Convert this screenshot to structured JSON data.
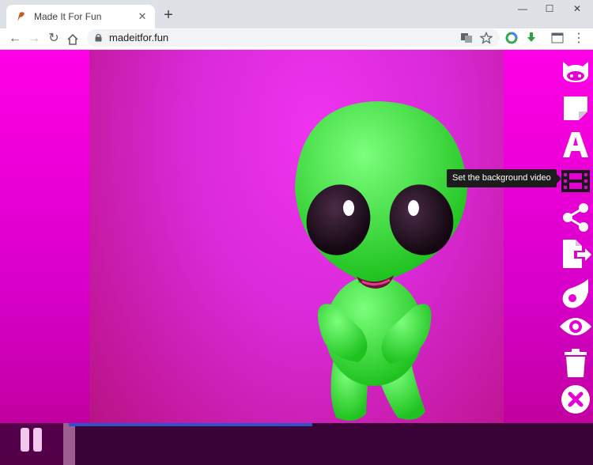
{
  "browser": {
    "tab_title": "Made It For Fun",
    "url": "madeitfor.fun",
    "minimize_label": "—",
    "maximize_label": "☐",
    "close_label": "✕"
  },
  "page": {
    "tooltip": "Set the background video",
    "progress": 0.46,
    "sidebar_items": [
      "github-icon",
      "sticky-note-icon",
      "text-icon",
      "film-icon",
      "share-icon",
      "export-icon",
      "meteor-icon",
      "eye-icon",
      "trash-icon",
      "close-circle-icon"
    ]
  },
  "colors": {
    "page_bg": "#e600d6",
    "progress": "#2f52c8",
    "tooltip_bg": "#1c1c1c",
    "icon": "#ffffff"
  }
}
